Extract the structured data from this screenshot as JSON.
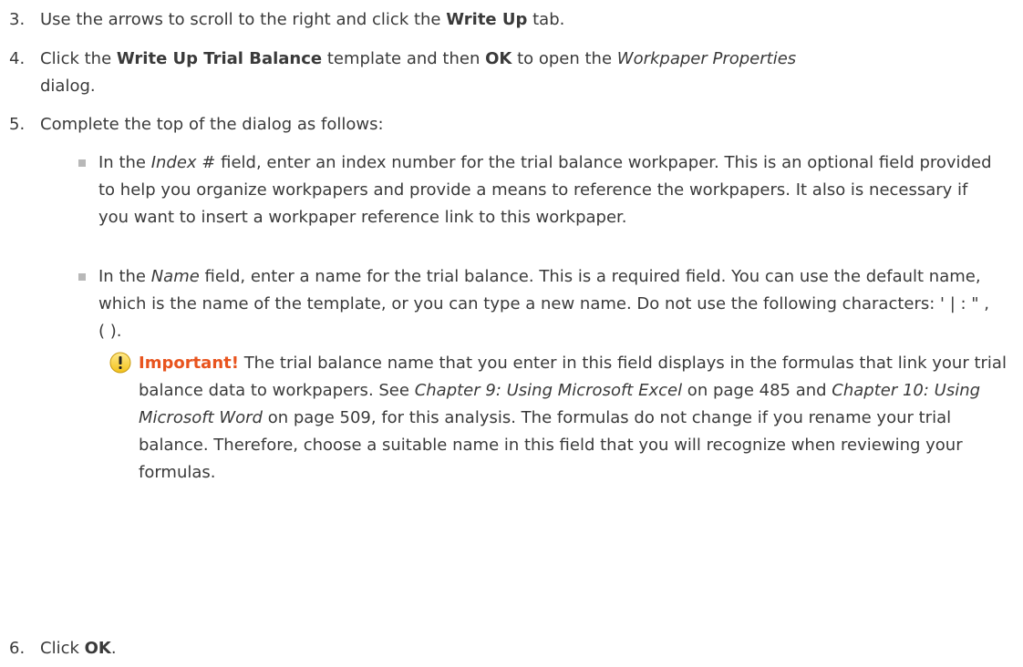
{
  "steps": {
    "s3": {
      "num": "3.",
      "pre": "Use the arrows to scroll to the right and click the ",
      "b1": "Write Up",
      "post": " tab."
    },
    "s4": {
      "num": "4.",
      "pre": "Click the ",
      "b1": "Write Up Trial Balance",
      "mid": " template and then ",
      "b2": "OK",
      "mid2": " to open the ",
      "i1": "Workpaper Properties",
      "post": " dialog."
    },
    "s5": {
      "num": "5.",
      "text": "Complete the top of the dialog as follows:"
    },
    "s6": {
      "num": "6.",
      "pre": "Click ",
      "b1": "OK",
      "post": "."
    }
  },
  "bullets": {
    "b1": {
      "pre": "In the ",
      "i1": "Index #",
      "post": " field, enter an index number for the trial balance workpaper. This is an optional field provided to help you organize workpapers and provide a means to reference the workpapers. It also is necessary if you want to insert a workpaper reference link to this workpaper."
    },
    "b2": {
      "pre": "In the ",
      "i1": "Name",
      "post": " field, enter a name for the trial balance. This is a required field. You can use the default name, which is the name of the template, or you can type a new name. Do not use the following characters: ' | : \" , ( )."
    }
  },
  "note": {
    "icon": "warning-icon",
    "label": "Important!",
    "t1": " The trial balance name that you enter in this field displays in the formulas that link your trial balance data to workpapers. See ",
    "i1": "Chapter 9: Using Microsoft Excel",
    "t2": " on page 485 and ",
    "i2": "Chapter 10: Using Microsoft Word",
    "t3": " on page 509, for this analysis. The formulas do not change if you rename your trial balance. Therefore, choose a suitable name in this field that you will recognize when reviewing your formulas."
  },
  "colors": {
    "important": "#e8541e",
    "text": "#3a3a3a",
    "bullet": "#b8b8b8"
  }
}
